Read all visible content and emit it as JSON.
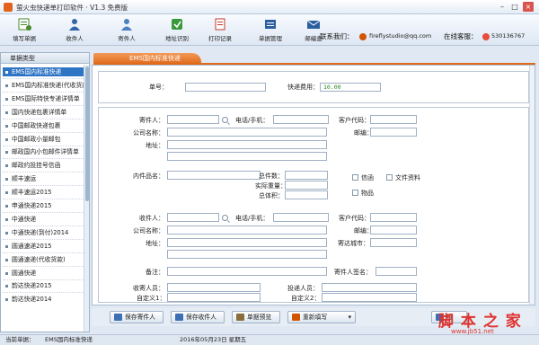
{
  "window": {
    "title": "萤火虫快递单打印软件 · V1.3 免费版",
    "minimize": "–",
    "maximize": "□",
    "close": "×"
  },
  "toolbar": {
    "items": [
      {
        "label": "填写单据",
        "icon": "fill-form-icon",
        "color": "#4a8a2e"
      },
      {
        "label": "收件人",
        "icon": "recipient-icon",
        "color": "#3465a4"
      },
      {
        "label": "寄件人",
        "icon": "sender-icon",
        "color": "#3465a4"
      },
      {
        "label": "地址识别",
        "icon": "address-recognize-icon",
        "color": "#3a9a3a"
      },
      {
        "label": "打印记录",
        "icon": "print-log-icon",
        "color": "#c0392b"
      },
      {
        "label": "单据管理",
        "icon": "bill-manage-icon",
        "color": "#2c5f9e"
      },
      {
        "label": "邮编查",
        "icon": "postcode-lookup-icon",
        "color": "#2c5f9e"
      }
    ],
    "contact_label": "联系我们：",
    "contact_email": "fireflystudio@qq.com",
    "support_label": "在线客服：",
    "support_qq": "530136767"
  },
  "left_panel": {
    "header": "单据类型",
    "items": [
      {
        "label": "EMS国内标准快递",
        "selected": true
      },
      {
        "label": "EMS国内标准快递(代收货款)",
        "selected": false
      },
      {
        "label": "EMS国际特快专递详情单",
        "selected": false
      },
      {
        "label": "国内快递包裹详情单",
        "selected": false
      },
      {
        "label": "中国邮政快递包裹",
        "selected": false
      },
      {
        "label": "中国邮政小量邮包",
        "selected": false
      },
      {
        "label": "邮政国内小包邮件详情单",
        "selected": false
      },
      {
        "label": "邮政约投挂号信函",
        "selected": false
      },
      {
        "label": "顺丰速运",
        "selected": false
      },
      {
        "label": "顺丰速运2015",
        "selected": false
      },
      {
        "label": "申通快递2015",
        "selected": false
      },
      {
        "label": "中通快递",
        "selected": false
      },
      {
        "label": "中通快递(到付)2014",
        "selected": false
      },
      {
        "label": "圆通速递2015",
        "selected": false
      },
      {
        "label": "圆通速递(代收货款)",
        "selected": false
      },
      {
        "label": "圆通快递",
        "selected": false
      },
      {
        "label": "韵达快递2015",
        "selected": false
      },
      {
        "label": "韵达快递2014",
        "selected": false
      }
    ]
  },
  "tab": {
    "label": "EMS国内标准快递"
  },
  "form": {
    "order_no_label": "单号：",
    "order_no_value": "",
    "fee_label": "快递费用：",
    "fee_value": "10.00",
    "sender_label": "寄件人：",
    "sender_phone_label": "电话/手机：",
    "sender_customer_code_label": "客户代码：",
    "sender_company_label": "公司名称：",
    "sender_postcode_label": "邮编：",
    "sender_address_label": "地址：",
    "item_name_label": "内件品名：",
    "total_count_label": "总件数：",
    "actual_weight_label": "实际重量：",
    "total_volume_label": "总体积：",
    "doc_label": "信函",
    "file_label": "文件资料",
    "goods_label": "物品",
    "recipient_label": "收件人：",
    "recipient_phone_label": "电话/手机：",
    "recipient_customer_code_label": "客户代码：",
    "recipient_company_label": "公司名称：",
    "recipient_postcode_label": "邮编：",
    "recipient_address_label": "地址：",
    "dest_city_label": "寄达城市：",
    "remark_label": "备注：",
    "sender_sign_label": "寄件人签名：",
    "collector_label": "收寄人员：",
    "deliverer_label": "投递人员：",
    "custom1_label": "自定义1：",
    "custom2_label": "自定义2："
  },
  "buttons": {
    "save_sender": "保存寄件人",
    "save_recipient": "保存收件人",
    "bill_preview": "单据预览",
    "refill": "重新填写",
    "print": "打"
  },
  "status": {
    "current_label": "当前单据：",
    "current_value": "EMS国内标准快递",
    "date": "2016年05月23日 星期五"
  },
  "watermark": {
    "text": "脚 本 之 家",
    "sub": "www.jb51.net"
  }
}
